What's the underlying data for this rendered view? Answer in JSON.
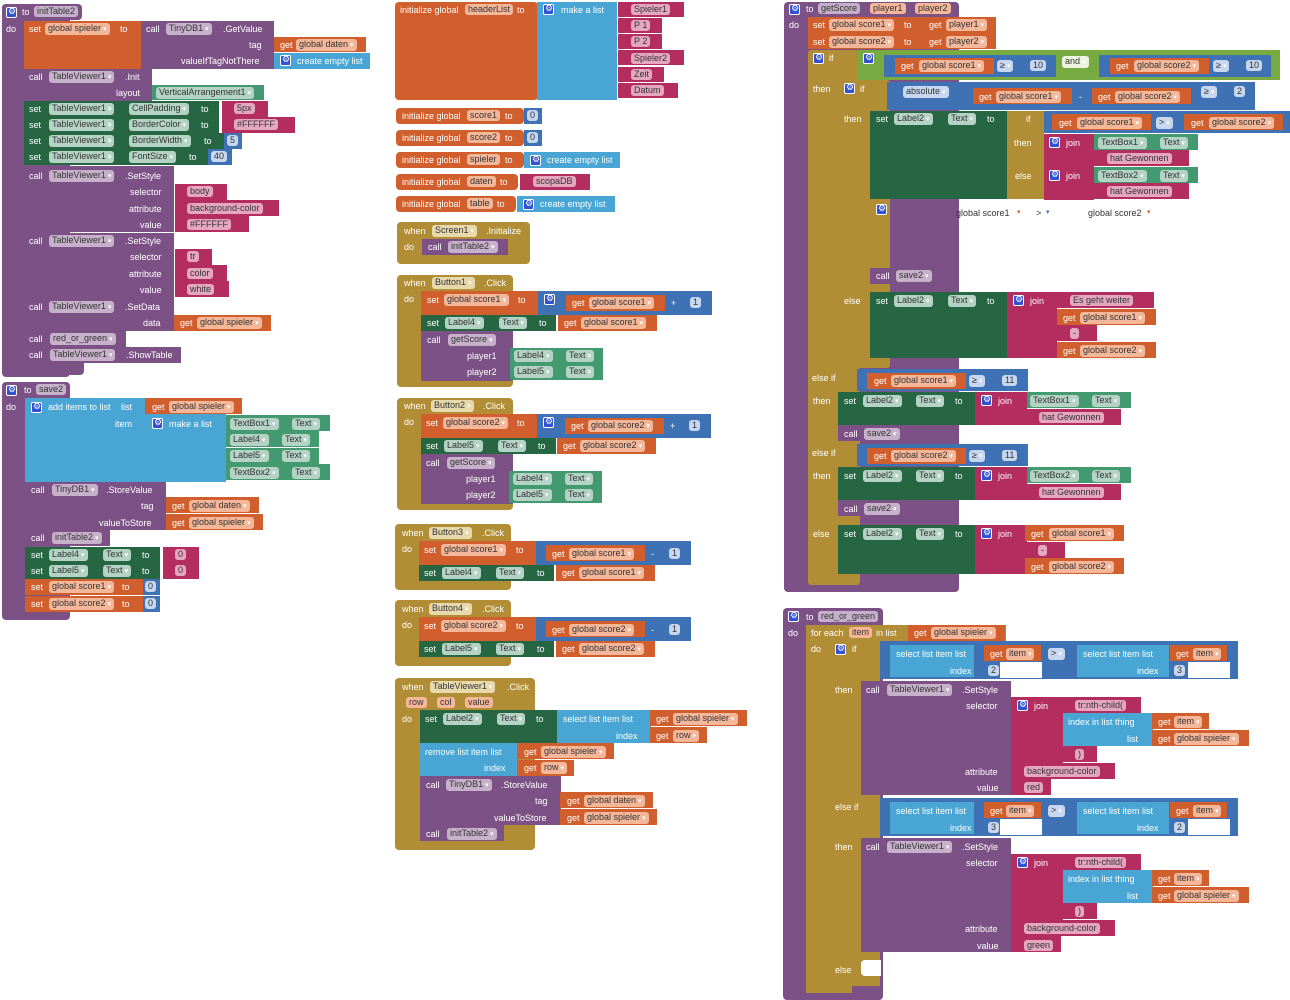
{
  "workspace": {
    "initTable2": {
      "header": "to",
      "name": "initTable2",
      "do": "do",
      "set_spieler": {
        "set": "set",
        "var": "global spieler",
        "to": "to"
      },
      "getvalue": {
        "call": "call",
        "comp": "TinyDB1",
        "method": ".GetValue",
        "tag": "tag",
        "tag_get": "get",
        "tag_var": "global daten",
        "vint": "valueIfTagNotThere",
        "empty": "create empty list"
      },
      "init": {
        "call": "call",
        "comp": "TableViewer1",
        "method": ".Init",
        "layout": "layout",
        "layout_val": "VerticalArrangement1"
      },
      "setters": [
        {
          "set": "set",
          "comp": "TableViewer1",
          "prop": "CellPadding",
          "to": "to",
          "val": "5px"
        },
        {
          "set": "set",
          "comp": "TableViewer1",
          "prop": "BorderColor",
          "to": "to",
          "val": "#FFFFFF"
        },
        {
          "set": "set",
          "comp": "TableViewer1",
          "prop": "BorderWidth",
          "to": "to",
          "val": "5"
        },
        {
          "set": "set",
          "comp": "TableViewer1",
          "prop": "FontSize",
          "to": "to",
          "val": "40"
        }
      ],
      "style1": {
        "call": "call",
        "comp": "TableViewer1",
        "method": ".SetStyle",
        "selector": "selector",
        "sel_val": "body",
        "attribute": "attribute",
        "attr_val": "background-color",
        "value": "value",
        "val": "#FFFFFF"
      },
      "style2": {
        "call": "call",
        "comp": "TableViewer1",
        "method": ".SetStyle",
        "selector": "selector",
        "sel_val": "tr",
        "attribute": "attribute",
        "attr_val": "color",
        "value": "value",
        "val": "white"
      },
      "setdata": {
        "call": "call",
        "comp": "TableViewer1",
        "method": ".SetData",
        "data": "data",
        "get": "get",
        "var": "global spieler"
      },
      "call_rog": {
        "call": "call",
        "name": "red_or_green"
      },
      "show": {
        "call": "call",
        "comp": "TableViewer1",
        "method": ".ShowTable"
      }
    },
    "save2": {
      "header": "to",
      "name": "save2",
      "do": "do",
      "add": {
        "label": "add items to list",
        "list": "list",
        "get": "get",
        "var": "global spieler",
        "item": "item",
        "make": "make a list"
      },
      "items": [
        {
          "comp": "TextBox1",
          "prop": "Text"
        },
        {
          "comp": "Label4",
          "prop": "Text"
        },
        {
          "comp": "Label5",
          "prop": "Text"
        },
        {
          "comp": "TextBox2",
          "prop": "Text"
        }
      ],
      "store": {
        "call": "call",
        "comp": "TinyDB1",
        "method": ".StoreValue",
        "tag": "tag",
        "tag_var": "global daten",
        "vts": "valueToStore",
        "vts_var": "global spieler",
        "get": "get"
      },
      "call_init": {
        "call": "call",
        "name": "initTable2"
      },
      "set_l4": {
        "set": "set",
        "comp": "Label4",
        "prop": "Text",
        "to": "to",
        "val": "0"
      },
      "set_l5": {
        "set": "set",
        "comp": "Label5",
        "prop": "Text",
        "to": "to",
        "val": "0"
      },
      "set_s1": {
        "set": "set",
        "var": "global score1",
        "to": "to",
        "val": "0"
      },
      "set_s2": {
        "set": "set",
        "var": "global score2",
        "to": "to",
        "val": "0"
      }
    },
    "globals": {
      "init_label": "initialize global",
      "to": "to",
      "headerList": {
        "name": "headerList",
        "make": "make a list",
        "items": [
          "Spieler1",
          "P 1",
          "P 2",
          "Spieler2",
          "Zeit",
          "Datum"
        ]
      },
      "score1": {
        "name": "score1",
        "val": "0"
      },
      "score2": {
        "name": "score2",
        "val": "0"
      },
      "spieler": {
        "name": "spieler",
        "val": "create empty list"
      },
      "daten": {
        "name": "daten",
        "val": "scopaDB"
      },
      "table": {
        "name": "table",
        "val": "create empty list"
      }
    },
    "screen_init": {
      "when": "when",
      "comp": "Screen1",
      "event": ".Initialize",
      "do": "do",
      "call": "call",
      "name": "initTable2"
    },
    "button1": {
      "when": "when",
      "comp": "Button1",
      "event": ".Click",
      "do": "do",
      "set": "set",
      "var": "global score1",
      "to": "to",
      "get": "get",
      "op": "+",
      "num": "1",
      "lbl": "Label4",
      "prop": "Text",
      "call": "call",
      "proc": "getScore",
      "p1": "player1",
      "p2": "player2",
      "p1c": "Label4",
      "p2c": "Label5"
    },
    "button2": {
      "when": "when",
      "comp": "Button2",
      "event": ".Click",
      "do": "do",
      "set": "set",
      "var": "global score2",
      "to": "to",
      "get": "get",
      "op": "+",
      "num": "1",
      "lbl": "Label5",
      "prop": "Text",
      "call": "call",
      "proc": "getScore",
      "p1": "player1",
      "p2": "player2",
      "p1c": "Label4",
      "p2c": "Label5"
    },
    "button3": {
      "when": "when",
      "comp": "Button3",
      "event": ".Click",
      "do": "do",
      "set": "set",
      "var": "global score1",
      "to": "to",
      "get": "get",
      "op": "-",
      "num": "1",
      "lbl": "Label4",
      "prop": "Text"
    },
    "button4": {
      "when": "when",
      "comp": "Button4",
      "event": ".Click",
      "do": "do",
      "set": "set",
      "var": "global score2",
      "to": "to",
      "get": "get",
      "op": "-",
      "num": "1",
      "lbl": "Label5",
      "prop": "Text"
    },
    "tv_click": {
      "when": "when",
      "comp": "TableViewer1",
      "event": ".Click",
      "params": [
        "row",
        "col",
        "value"
      ],
      "do": "do",
      "set": "set",
      "lbl": "Label2",
      "prop": "Text",
      "to": "to",
      "select": "select list item list",
      "get": "get",
      "var": "global spieler",
      "index": "index",
      "row": "row",
      "remove": "remove list item list",
      "call": "call",
      "db": "TinyDB1",
      "store": ".StoreValue",
      "tag": "tag",
      "tag_var": "global daten",
      "vts": "valueToStore",
      "proc": "initTable2"
    },
    "getScore": {
      "header": "to",
      "name": "getScore",
      "params": [
        "player1",
        "player2"
      ],
      "do": "do",
      "set": "set",
      "get": "get",
      "to": "to",
      "s1": "global score1",
      "s2": "global score2",
      "if": "if",
      "then": "then",
      "else": "else",
      "elseif": "else if",
      "ge": "≥",
      "gt": ">",
      "and": "and",
      "ten": "10",
      "absolute": "absolute",
      "minus": "-",
      "two": "2",
      "eleven": "11",
      "label2": "Label2",
      "text": "Text",
      "join": "join",
      "tb1": "TextBox1",
      "tb2": "TextBox2",
      "won": "hat Gewonnen",
      "ghost": {
        "a": "global score1",
        "op": ">",
        "b": "global score2"
      },
      "call": "call",
      "save2": "save2",
      "es": "Es geht weiter",
      "dash": "-"
    },
    "red_or_green": {
      "header": "to",
      "name": "red_or_green",
      "do": "do",
      "foreach": "for each",
      "item": "item",
      "inlist": "in list",
      "get": "get",
      "var": "global spieler",
      "if": "if",
      "then": "then",
      "elseif": "else if",
      "else": "else",
      "select": "select list item list",
      "index": "index",
      "gt": ">",
      "call": "call",
      "comp": "TableViewer1",
      "method": ".SetStyle",
      "selector": "selector",
      "join": "join",
      "nth": "tr:nth-child(",
      "iil": "index in list  thing",
      "list": "list",
      "close": ")",
      "attribute": "attribute",
      "bg": "background-color",
      "value": "value",
      "red": "red",
      "green": "green",
      "i2": "2",
      "i3": "3"
    }
  }
}
